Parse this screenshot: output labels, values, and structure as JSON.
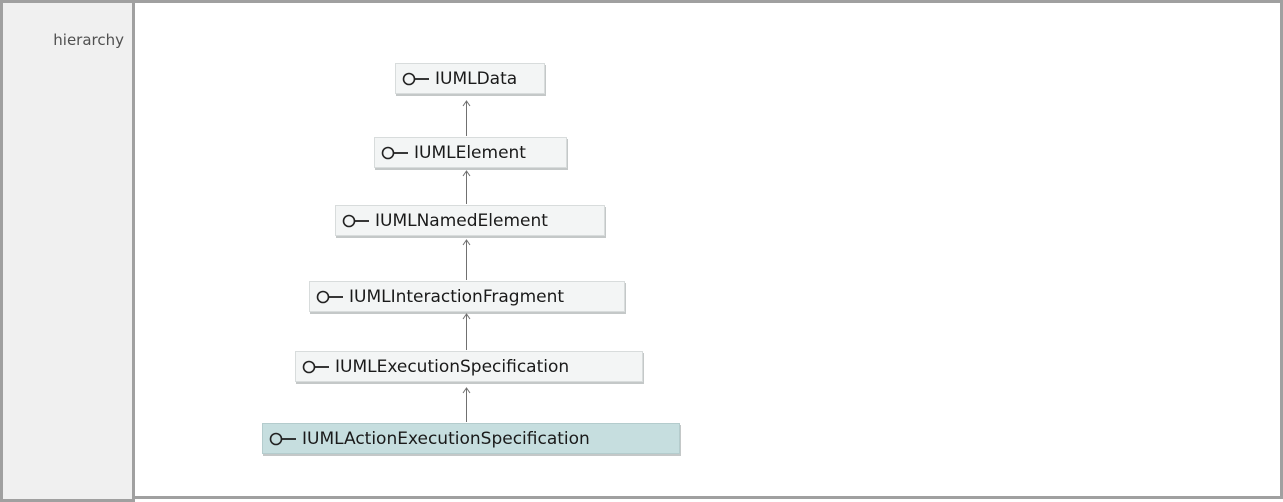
{
  "row_label": "hierarchy",
  "nodes": [
    {
      "name": "IUMLData"
    },
    {
      "name": "IUMLElement"
    },
    {
      "name": "IUMLNamedElement"
    },
    {
      "name": "IUMLInteractionFragment"
    },
    {
      "name": "IUMLExecutionSpecification"
    },
    {
      "name": "IUMLActionExecutionSpecification"
    }
  ],
  "selected_node": "IUMLActionExecutionSpecification",
  "colors": {
    "node_bg": "#f3f5f5",
    "selected_bg": "#c6dedf",
    "border": "#a0a0a0"
  },
  "icon": "interface-lollipop-icon"
}
